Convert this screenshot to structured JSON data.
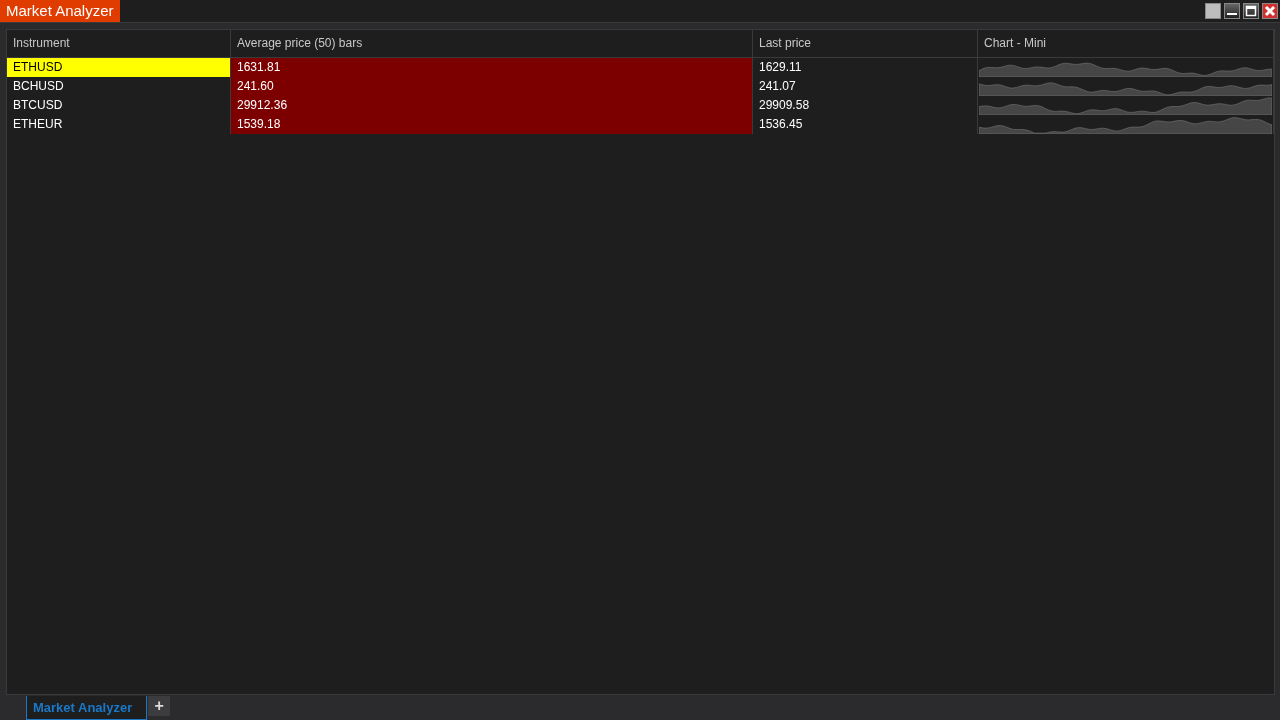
{
  "window": {
    "title": "Market Analyzer"
  },
  "table": {
    "columns": [
      "Instrument",
      "Average price (50) bars",
      "Last price",
      "Chart - Mini"
    ],
    "rows": [
      {
        "instrument": "ETHUSD",
        "selected": true,
        "average": "1631.81",
        "average_alert": true,
        "last": "1629.11"
      },
      {
        "instrument": "BCHUSD",
        "selected": false,
        "average": "241.60",
        "average_alert": true,
        "last": "241.07"
      },
      {
        "instrument": "BTCUSD",
        "selected": false,
        "average": "29912.36",
        "average_alert": true,
        "last": "29909.58"
      },
      {
        "instrument": "ETHEUR",
        "selected": false,
        "average": "1539.18",
        "average_alert": true,
        "last": "1536.45"
      }
    ]
  },
  "tabs": [
    {
      "label": "Market Analyzer",
      "selected": true
    }
  ],
  "add_tab": "+"
}
